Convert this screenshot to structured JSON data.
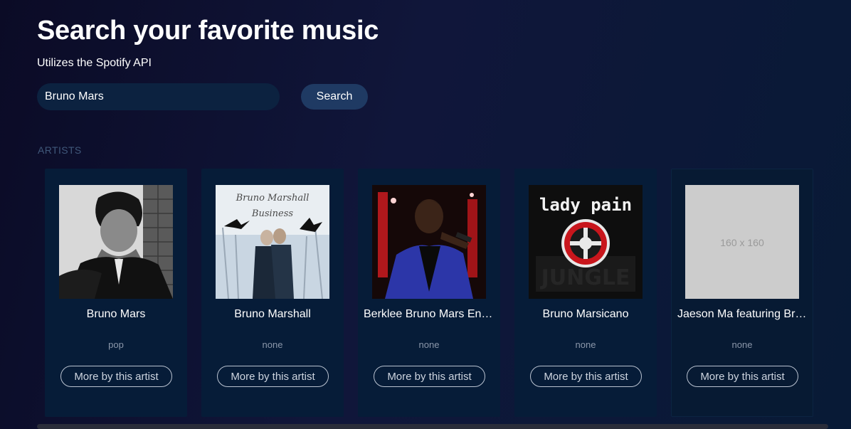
{
  "header": {
    "title": "Search your favorite music",
    "subtitle": "Utilizes the Spotify API"
  },
  "search": {
    "value": "Bruno Mars",
    "button_label": "Search"
  },
  "section": {
    "label": "ARTISTS"
  },
  "artists": [
    {
      "name": "Bruno Mars",
      "genre": "pop",
      "more_label": "More by this artist"
    },
    {
      "name": "Bruno Marshall",
      "genre": "none",
      "more_label": "More by this artist",
      "image_text": "Bruno Marshall Business"
    },
    {
      "name": "Berklee Bruno Mars Ensemble",
      "genre": "none",
      "more_label": "More by this artist"
    },
    {
      "name": "Bruno Marsicano",
      "genre": "none",
      "more_label": "More by this artist",
      "image_text": "lady pain"
    },
    {
      "name": "Jaeson Ma featuring Bruno Mars",
      "genre": "none",
      "more_label": "More by this artist",
      "image_text": "160 x 160"
    }
  ],
  "colors": {
    "background": "#0b0b26",
    "card": "#061c38",
    "input": "#0c2240",
    "button": "#1f3a63"
  }
}
